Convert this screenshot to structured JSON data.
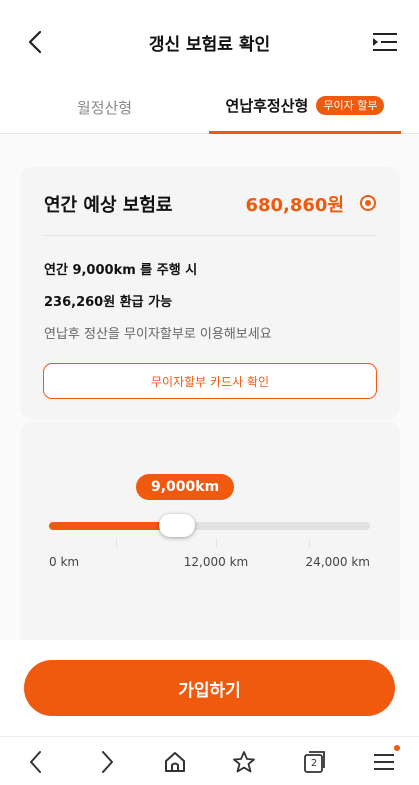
{
  "header": {
    "title": "갱신 보험료 확인"
  },
  "tabs": [
    {
      "label": "월정산형"
    },
    {
      "label": "연납후정산형",
      "badge": "무이자 할부",
      "active": true
    }
  ],
  "premium_card": {
    "title": "연간 예상 보험료",
    "amount": "680,860원",
    "line1": "연간 9,000km 를 주행 시",
    "line2": "236,260원 환급 가능",
    "line3": "연납후 정산을 무이자할부로 이용해보세요",
    "button_label": "무이자할부 카드사 확인"
  },
  "mileage_slider": {
    "value_label": "9,000km",
    "value_km": 9000,
    "min_km": 0,
    "max_km": 24000,
    "scale_labels": [
      "0 km",
      "12,000 km",
      "24,000 km"
    ]
  },
  "join_button": {
    "label": "가입하기"
  },
  "browser_bar": {
    "tab_count": "2"
  },
  "colors": {
    "accent": "#f05a0f",
    "card_background": "#f5f5f5",
    "track": "#e1e1e1"
  },
  "icons": [
    "chevron-left-icon",
    "list-menu-icon",
    "info-icon",
    "chevron-right-icon",
    "home-icon",
    "star-icon",
    "tabs-icon",
    "hamburger-icon"
  ]
}
